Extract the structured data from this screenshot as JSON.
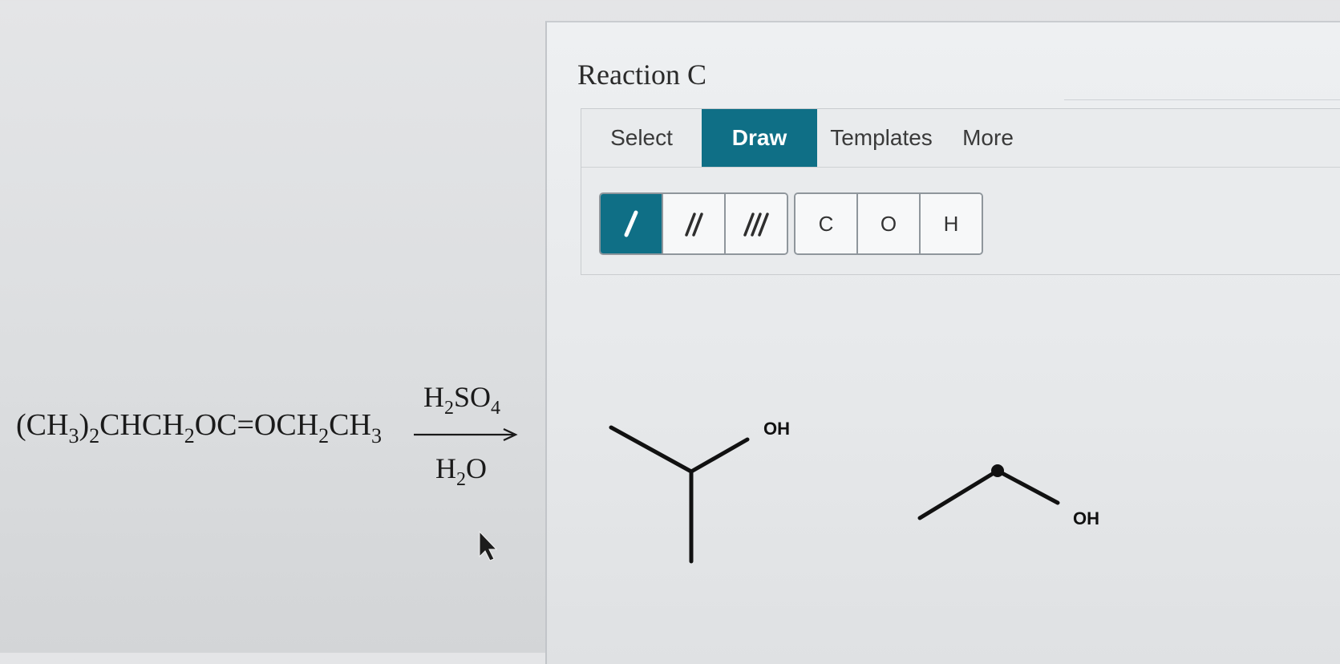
{
  "reaction": {
    "reactant": {
      "t1": "(CH",
      "s1": "3",
      "t2": ")",
      "s2": "2",
      "t3": "CHCH",
      "s3": "2",
      "t4": "OC=OCH",
      "s4": "2",
      "t5": "CH",
      "s5": "3"
    },
    "reagent_top": {
      "t1": "H",
      "s1": "2",
      "t2": "SO",
      "s2": "4"
    },
    "reagent_bottom": {
      "t1": "H",
      "s1": "2",
      "t2": "O"
    }
  },
  "panel": {
    "title": "Reaction C"
  },
  "toolbar": {
    "tabs": [
      "Select",
      "Draw",
      "Templates",
      "More"
    ],
    "active_tab": "Draw",
    "bond_buttons": [
      "single-bond-icon",
      "double-bond-icon",
      "triple-bond-icon"
    ],
    "active_bond": "single-bond-icon",
    "atom_buttons": [
      "C",
      "O",
      "H"
    ]
  },
  "canvas": {
    "molecules": [
      {
        "label": "OH"
      },
      {
        "label": "OH"
      }
    ]
  },
  "colors": {
    "accent": "#0f6f86",
    "ink": "#111111"
  }
}
